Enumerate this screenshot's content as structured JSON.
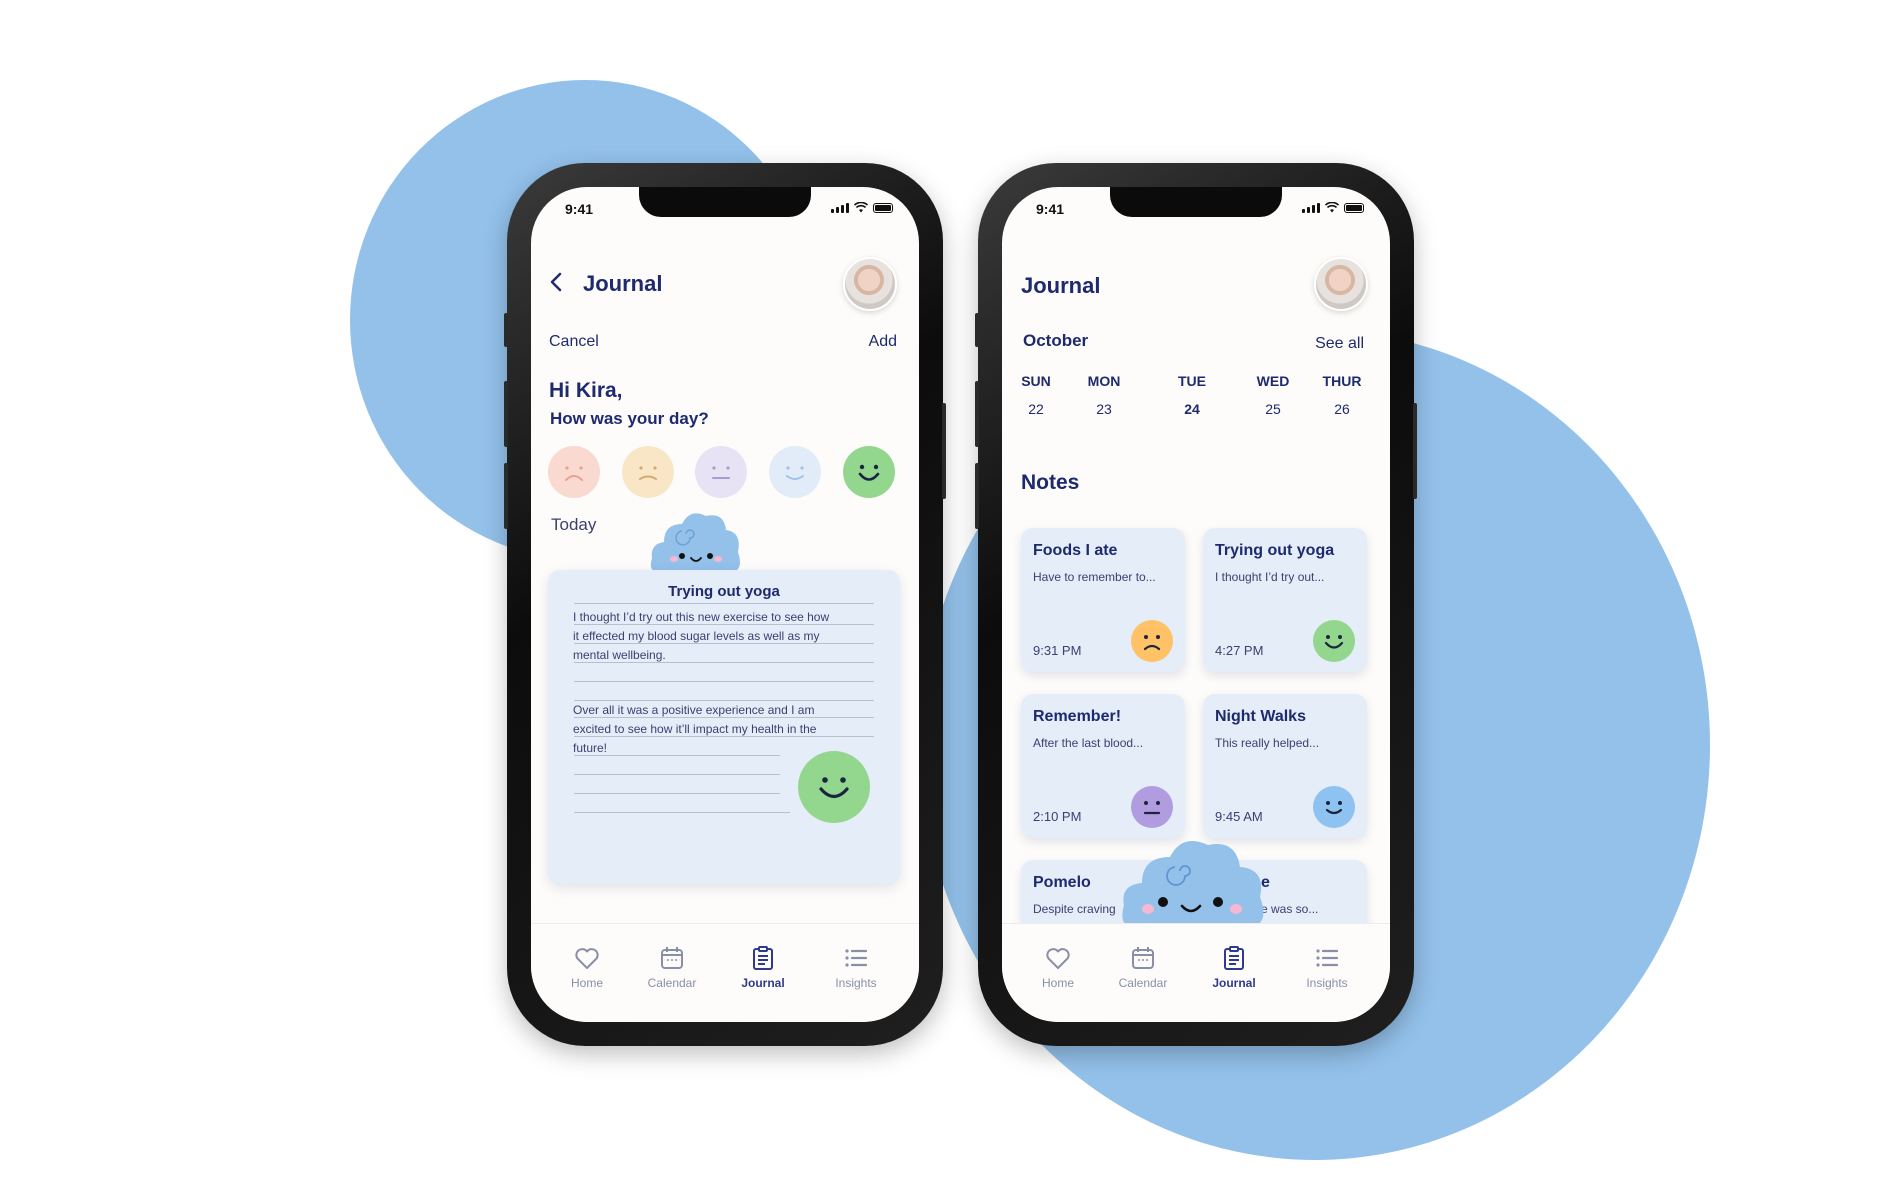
{
  "status": {
    "time": "9:41"
  },
  "left": {
    "header": {
      "title": "Journal"
    },
    "actions": {
      "cancel": "Cancel",
      "add": "Add"
    },
    "greeting": {
      "name": "Hi Kira,",
      "question": "How was your day?"
    },
    "moods": [
      {
        "icon": "very-sad-face-icon",
        "color": "#f9d9d0"
      },
      {
        "icon": "sad-face-icon",
        "color": "#f9e6c7"
      },
      {
        "icon": "neutral-face-icon",
        "color": "#e7e2f4"
      },
      {
        "icon": "calm-face-icon",
        "color": "#e1ecf8"
      },
      {
        "icon": "happy-face-icon",
        "color": "#93d68e"
      }
    ],
    "section_label": "Today",
    "entry": {
      "title": "Trying out yoga",
      "lines": [
        "I thought I’d try out this new exercise to see how",
        "it effected my blood sugar levels as well as my",
        "mental wellbeing.",
        "Over all it was a positive experience and I am",
        "excited to see how it’ll impact my health in the",
        "future!"
      ],
      "mood_icon": "happy-face-icon"
    }
  },
  "right": {
    "header": {
      "title": "Journal"
    },
    "calendar": {
      "month": "October",
      "see_all": "See all",
      "days": [
        {
          "name": "SUN",
          "date": "22"
        },
        {
          "name": "MON",
          "date": "23"
        },
        {
          "name": "TUE",
          "date": "24",
          "selected": true
        },
        {
          "name": "WED",
          "date": "25"
        },
        {
          "name": "THUR",
          "date": "26"
        }
      ]
    },
    "notes_title": "Notes",
    "notes": [
      {
        "title": "Foods I ate",
        "snippet": "Have to remember to...",
        "time": "9:31 PM",
        "mood_icon": "sad-face-icon",
        "mood_color": "#ffc266"
      },
      {
        "title": "Trying out yoga",
        "snippet": "I thought I’d try out...",
        "time": "4:27 PM",
        "mood_icon": "happy-face-icon",
        "mood_color": "#93d68e"
      },
      {
        "title": "Remember!",
        "snippet": "After the last blood...",
        "time": "2:10 PM",
        "mood_icon": "neutral-face-icon",
        "mood_color": "#b19ce0"
      },
      {
        "title": "Night Walks",
        "snippet": "This really helped...",
        "time": "9:45 AM",
        "mood_icon": "calm-face-icon",
        "mood_color": "#8ec2f0"
      },
      {
        "title": "Pomelo",
        "snippet": "Despite craving",
        "time": "",
        "mood_icon": "",
        "mood_color": ""
      },
      {
        "title": "e",
        "snippet": "e was so...",
        "time": "",
        "mood_icon": "",
        "mood_color": ""
      }
    ]
  },
  "tabs": [
    {
      "label": "Home",
      "icon": "heart-icon"
    },
    {
      "label": "Calendar",
      "icon": "calendar-icon"
    },
    {
      "label": "Journal",
      "icon": "clipboard-icon",
      "active": true
    },
    {
      "label": "Insights",
      "icon": "list-icon"
    }
  ],
  "colors": {
    "primary": "#1e2a6e",
    "accent_blue": "#93c1ea",
    "card_bg": "#e4edf8"
  }
}
